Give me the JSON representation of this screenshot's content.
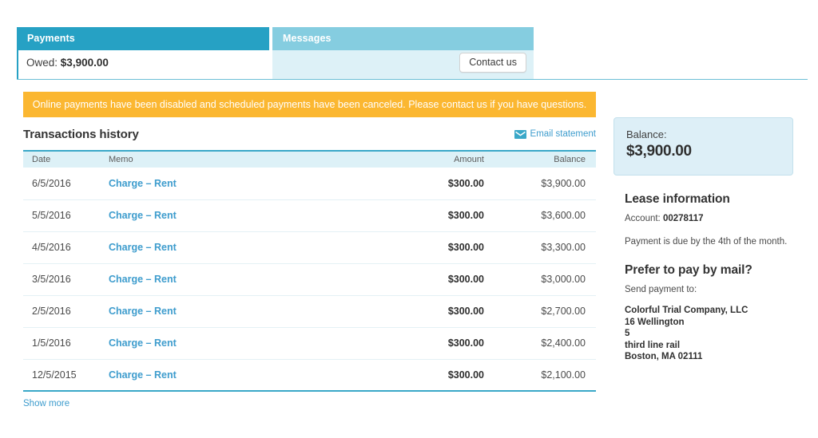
{
  "tabs": [
    {
      "label": "Payments",
      "active": true,
      "owed_label": "Owed:",
      "owed_amount": "$3,900.00"
    },
    {
      "label": "Messages",
      "active": false,
      "contact_button": "Contact us"
    }
  ],
  "tab_strip": {
    "payments_label": "Payments",
    "messages_label": "Messages",
    "owed_label": "Owed:",
    "owed_amount": "$3,900.00",
    "contact_us_label": "Contact us"
  },
  "alert": {
    "message": "Online payments have been disabled and scheduled payments have been canceled. Please contact us if you have questions.",
    "background_color": "#fbb731",
    "text_color": "#ffffff"
  },
  "transactions": {
    "title": "Transactions history",
    "email_statement_label": "Email statement",
    "email_statement_icon": "envelope-icon",
    "columns": [
      "Date",
      "Memo",
      "Amount",
      "Balance"
    ],
    "rows": [
      {
        "date": "6/5/2016",
        "memo": "Charge – Rent",
        "amount": "$300.00",
        "balance": "$3,900.00"
      },
      {
        "date": "5/5/2016",
        "memo": "Charge – Rent",
        "amount": "$300.00",
        "balance": "$3,600.00"
      },
      {
        "date": "4/5/2016",
        "memo": "Charge – Rent",
        "amount": "$300.00",
        "balance": "$3,300.00"
      },
      {
        "date": "3/5/2016",
        "memo": "Charge – Rent",
        "amount": "$300.00",
        "balance": "$3,000.00"
      },
      {
        "date": "2/5/2016",
        "memo": "Charge – Rent",
        "amount": "$300.00",
        "balance": "$2,700.00"
      },
      {
        "date": "1/5/2016",
        "memo": "Charge – Rent",
        "amount": "$300.00",
        "balance": "$2,400.00"
      },
      {
        "date": "12/5/2015",
        "memo": "Charge – Rent",
        "amount": "$300.00",
        "balance": "$2,100.00"
      }
    ],
    "show_more_label": "Show more"
  },
  "sidebar": {
    "balance_label": "Balance:",
    "balance_amount": "$3,900.00",
    "lease": {
      "heading": "Lease information",
      "account_label": "Account:",
      "account_number": "00278117",
      "due_note": "Payment is due by the 4th of the month."
    },
    "mail": {
      "heading": "Prefer to pay by mail?",
      "send_to_label": "Send payment to:",
      "address_lines": [
        "Colorful Trial Company, LLC",
        "16 Wellington",
        "5",
        "third line rail",
        "Boston, MA 02111"
      ]
    }
  },
  "colors": {
    "active_tab": "#26a1c4",
    "inactive_tab": "#85cde0",
    "inactive_tab_body": "#ddf1f7",
    "link": "#3d9ccd",
    "alert": "#fbb731",
    "table_header_bg": "#ddf1f7",
    "rule": "#3aa8c8",
    "balance_box_bg": "#ddeff7"
  }
}
